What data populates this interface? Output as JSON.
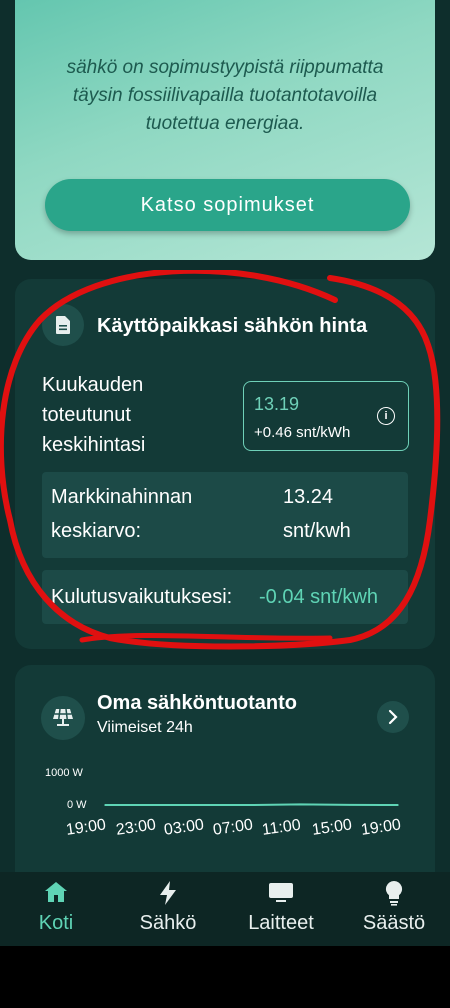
{
  "promo": {
    "text_line1": "sähkö on sopimustyypistä riippumatta",
    "text_line2": "täysin fossiilivapailla tuotantotavoilla",
    "text_line3": "tuotettua energiaa.",
    "button_label": "Katso sopimukset"
  },
  "price_card": {
    "title": "Käyttöpaikkasi sähkön hinta",
    "month_label_line1": "Kuukauden",
    "month_label_line2": "toteutunut",
    "month_label_line3": "keskihintasi",
    "price_value": "13.19",
    "price_delta": "+0.46 snt/kWh",
    "market_label_line1": "Markkinahinnan",
    "market_label_line2": "keskiarvo:",
    "market_value_line1": "13.24",
    "market_value_line2": "snt/kwh",
    "impact_label": "Kulutusvaikutuksesi:",
    "impact_value": "-0.04 snt/kwh"
  },
  "production_card": {
    "title": "Oma sähköntuotanto",
    "subtitle": "Viimeiset 24h",
    "y_labels": [
      "1000 W",
      "0 W"
    ],
    "x_ticks": [
      "19:00",
      "23:00",
      "03:00",
      "07:00",
      "11:00",
      "15:00",
      "19:00"
    ]
  },
  "chart_data": {
    "type": "line",
    "x": [
      "19:00",
      "23:00",
      "03:00",
      "07:00",
      "11:00",
      "15:00",
      "19:00"
    ],
    "series": [
      {
        "values": [
          0,
          0,
          0,
          0,
          20,
          5,
          0
        ]
      }
    ],
    "ylim": [
      0,
      1000
    ],
    "ylabel": "",
    "xlabel": ""
  },
  "nav": {
    "items": [
      {
        "label": "Koti",
        "icon": "home-icon",
        "active": true
      },
      {
        "label": "Sähkö",
        "icon": "lightning-icon",
        "active": false
      },
      {
        "label": "Laitteet",
        "icon": "device-icon",
        "active": false
      },
      {
        "label": "Säästö",
        "icon": "lightbulb-icon",
        "active": false
      }
    ]
  },
  "colors": {
    "background": "#0e2e2c",
    "card": "#133a37",
    "accent": "#5fd4b5",
    "annotation": "#e01010"
  }
}
